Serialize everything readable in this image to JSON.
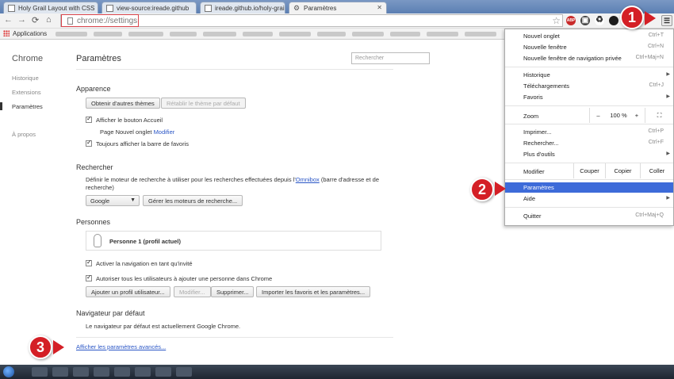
{
  "browser": {
    "tabs": [
      {
        "title": "Holy Grail Layout with CSS"
      },
      {
        "title": "view-source:ireade.github"
      },
      {
        "title": "ireade.github.io/holy-grai"
      },
      {
        "title": "Paramètres"
      }
    ],
    "url": "chrome://settings",
    "bookmarks_apps": "Applications",
    "ext_abp": "ABP"
  },
  "leftnav": {
    "title": "Chrome",
    "items": [
      "Historique",
      "Extensions",
      "Paramètres",
      "À propos"
    ]
  },
  "settings": {
    "title": "Paramètres",
    "search_placeholder": "Rechercher",
    "appearance": {
      "heading": "Apparence",
      "get_themes": "Obtenir d'autres thèmes",
      "reset_theme": "Rétablir le thème par défaut",
      "show_home": "Afficher le bouton Accueil",
      "new_tab_page": "Page Nouvel onglet",
      "modify": "Modifier",
      "show_bookmarks": "Toujours afficher la barre de favoris"
    },
    "search": {
      "heading": "Rechercher",
      "desc_before": "Définir le moteur de recherche à utiliser pour les recherches effectuées depuis l'",
      "omnibox": "Omnibox",
      "desc_after": " (barre d'adresse et de",
      "desc_line2": "recherche)",
      "engine": "Google",
      "manage": "Gérer les moteurs de recherche..."
    },
    "people": {
      "heading": "Personnes",
      "person": "Personne 1 (profil actuel)",
      "guest": "Activer la navigation en tant qu'invité",
      "allow_add": "Autoriser tous les utilisateurs à ajouter une personne dans Chrome",
      "add": "Ajouter un profil utilisateur...",
      "edit": "Modifier...",
      "remove": "Supprimer...",
      "import": "Importer les favoris et les paramètres..."
    },
    "default_browser": {
      "heading": "Navigateur par défaut",
      "text": "Le navigateur par défaut est actuellement Google Chrome."
    },
    "advanced_link": "Afficher les paramètres avancés..."
  },
  "menu": {
    "new_tab": {
      "label": "Nouvel onglet",
      "shortcut": "Ctrl+T"
    },
    "new_window": {
      "label": "Nouvelle fenêtre",
      "shortcut": "Ctrl+N"
    },
    "incognito": {
      "label": "Nouvelle fenêtre de navigation privée",
      "shortcut": "Ctrl+Maj+N"
    },
    "history": {
      "label": "Historique"
    },
    "downloads": {
      "label": "Téléchargements",
      "shortcut": "Ctrl+J"
    },
    "bookmarks": {
      "label": "Favoris"
    },
    "zoom": {
      "label": "Zoom",
      "minus": "–",
      "value": "100 %",
      "plus": "+"
    },
    "print": {
      "label": "Imprimer...",
      "shortcut": "Ctrl+P"
    },
    "find": {
      "label": "Rechercher...",
      "shortcut": "Ctrl+F"
    },
    "more_tools": {
      "label": "Plus d'outils"
    },
    "edit": {
      "label": "Modifier",
      "cut": "Couper",
      "copy": "Copier",
      "paste": "Coller"
    },
    "settings": {
      "label": "Paramètres"
    },
    "help": {
      "label": "Aide"
    },
    "quit": {
      "label": "Quitter",
      "shortcut": "Ctrl+Maj+Q"
    }
  },
  "steps": [
    "1",
    "2",
    "3"
  ],
  "colors": {
    "badge": "#d41f26",
    "highlight": "#3d6bd9",
    "link": "#2a56c6"
  }
}
